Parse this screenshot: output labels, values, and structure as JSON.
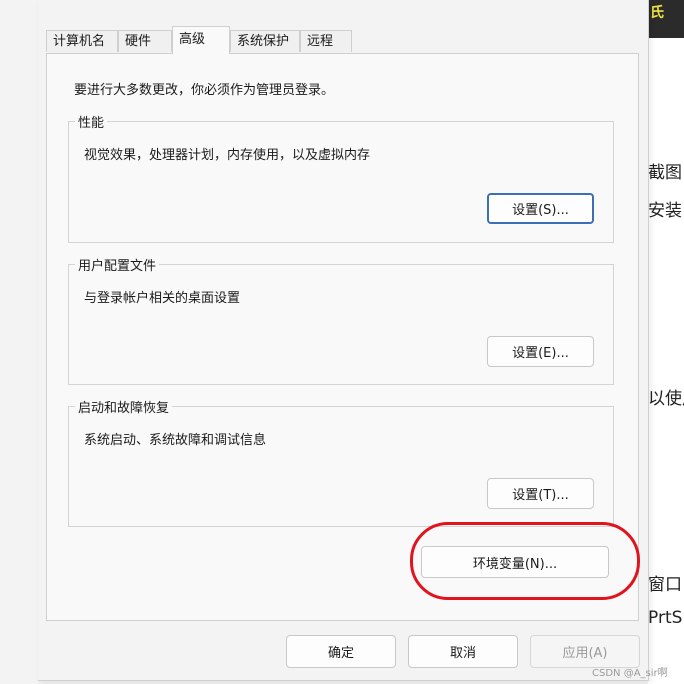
{
  "background": {
    "corner_text": "氏",
    "fragments": [
      "截图",
      "安装",
      "以使用",
      "窗口",
      "PrtS"
    ]
  },
  "tabs": [
    {
      "label": "计算机名"
    },
    {
      "label": "硬件"
    },
    {
      "label": "高级",
      "active": true
    },
    {
      "label": "系统保护"
    },
    {
      "label": "远程"
    }
  ],
  "admin_note": "要进行大多数更改，你必须作为管理员登录。",
  "performance": {
    "title": "性能",
    "description": "视觉效果，处理器计划，内存使用，以及虚拟内存",
    "button_label": "设置(S)..."
  },
  "user_profiles": {
    "title": "用户配置文件",
    "description": "与登录帐户相关的桌面设置",
    "button_label": "设置(E)..."
  },
  "startup_recovery": {
    "title": "启动和故障恢复",
    "description": "系统启动、系统故障和调试信息",
    "button_label": "设置(T)..."
  },
  "env_button_label": "环境变量(N)...",
  "footer": {
    "ok_label": "确定",
    "cancel_label": "取消",
    "apply_label": "应用(A)"
  },
  "watermark": "CSDN @A_sir啊",
  "colors": {
    "highlight": "#e0141e",
    "focus": "#3b6fb6"
  }
}
